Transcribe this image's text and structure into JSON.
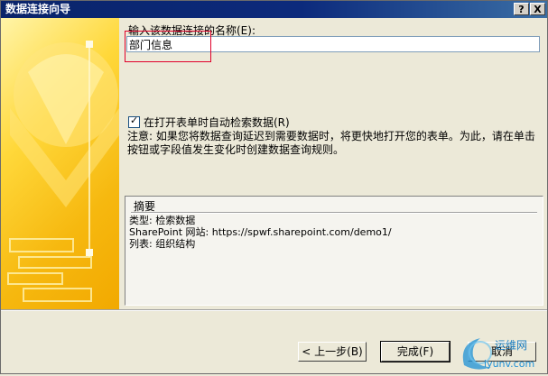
{
  "window": {
    "title": "数据连接向导",
    "help_glyph": "?",
    "close_glyph": "X"
  },
  "form": {
    "name_label": "输入该数据连接的名称(E):",
    "name_value": "部门信息",
    "auto_retrieve_label": "在打开表单时自动检索数据(R)",
    "auto_retrieve_checked": true,
    "note": "注意: 如果您将数据查询延迟到需要数据时，将更快地打开您的表单。为此，请在单击按钮或字段值发生变化时创建数据查询规则。"
  },
  "summary": {
    "title": "摘要",
    "lines": [
      "类型: 检索数据",
      "SharePoint 网站: https://spwf.sharepoint.com/demo1/",
      "列表: 组织结构"
    ]
  },
  "buttons": {
    "back": "< 上一步(B)",
    "finish": "完成(F)",
    "cancel": "取消"
  },
  "watermark": {
    "line1": "运维网",
    "line2": "iyunv.com"
  },
  "colors": {
    "titlebar": "#0a246a",
    "highlight": "#e0002a",
    "sidebar": "#f6b80f"
  }
}
